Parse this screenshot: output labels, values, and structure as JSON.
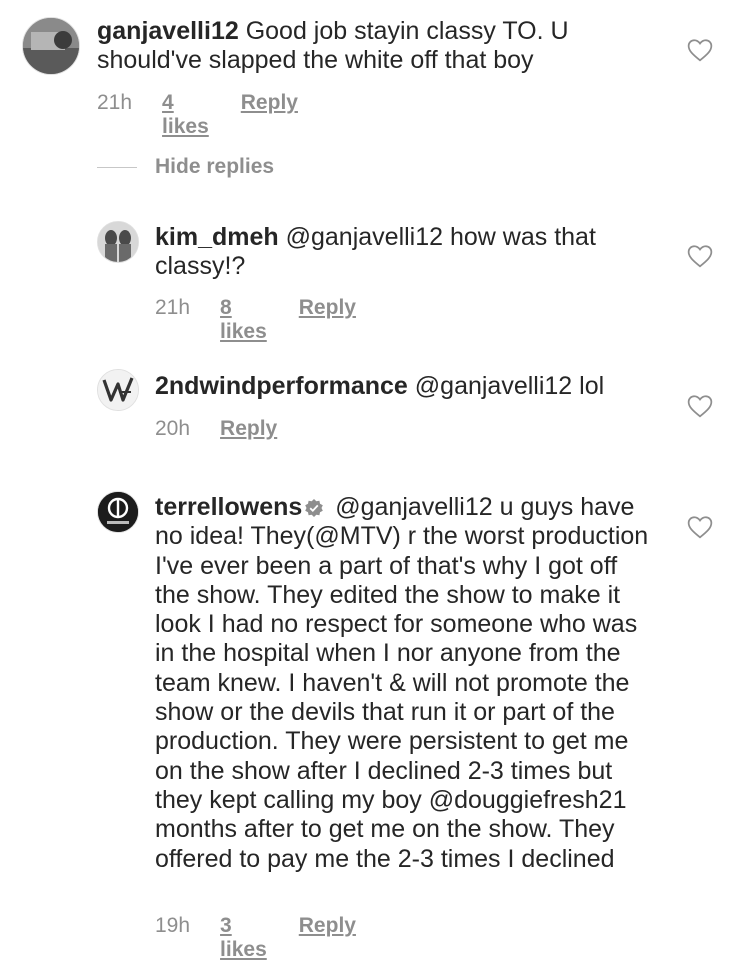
{
  "comments": [
    {
      "username": "ganjavelli12",
      "text": "Good job stayin classy TO. U should've slapped the white off that boy",
      "time": "21h",
      "likes": "4 likes",
      "reply": "Reply"
    }
  ],
  "hide_replies": "Hide replies",
  "replies": [
    {
      "username": "kim_dmeh",
      "text": "@ganjavelli12 how was that classy!?",
      "time": "21h",
      "likes": "8 likes",
      "reply": "Reply"
    },
    {
      "username": "2ndwindperformance",
      "text": "@ganjavelli12 lol",
      "time": "20h",
      "reply": "Reply"
    },
    {
      "username": "terrellowens",
      "verified": true,
      "text": "@ganjavelli12 u guys have no idea! They(@MTV) r the worst production I've ever been a part of that's why I got off the show. They edited the show to make it look I had no respect for someone who was in the hospital when I nor anyone from the team knew. I haven't & will not promote the show or the devils that run it or part of the production. They were persistent to get me on the show after I declined 2-3 times but they kept calling my boy @douggiefresh21 months after to get me on the show. They offered to pay me the 2-3 times I declined",
      "time": "19h",
      "likes": "3 likes",
      "reply": "Reply"
    }
  ],
  "icons": {
    "heart": "heart-outline-icon",
    "verified": "verified-badge-icon"
  }
}
